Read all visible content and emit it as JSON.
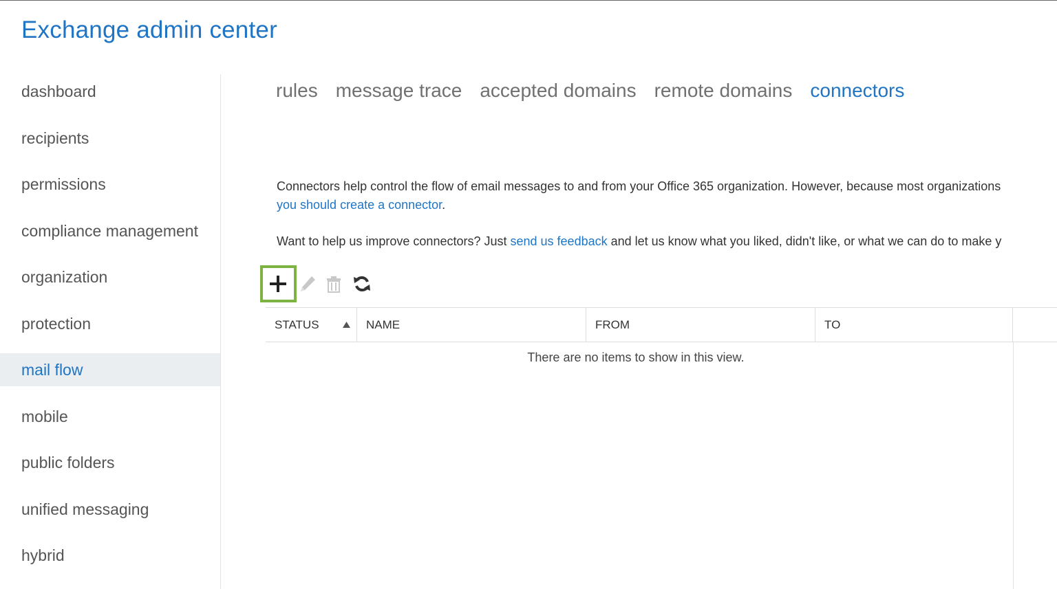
{
  "app": {
    "title": "Exchange admin center"
  },
  "sidebar": {
    "items": [
      {
        "label": "dashboard",
        "active": false
      },
      {
        "label": "recipients",
        "active": false
      },
      {
        "label": "permissions",
        "active": false
      },
      {
        "label": "compliance management",
        "active": false
      },
      {
        "label": "organization",
        "active": false
      },
      {
        "label": "protection",
        "active": false
      },
      {
        "label": "mail flow",
        "active": true
      },
      {
        "label": "mobile",
        "active": false
      },
      {
        "label": "public folders",
        "active": false
      },
      {
        "label": "unified messaging",
        "active": false
      },
      {
        "label": "hybrid",
        "active": false
      }
    ]
  },
  "tabs": [
    {
      "label": "rules",
      "active": false
    },
    {
      "label": "message trace",
      "active": false
    },
    {
      "label": "accepted domains",
      "active": false
    },
    {
      "label": "remote domains",
      "active": false
    },
    {
      "label": "connectors",
      "active": true
    }
  ],
  "description": {
    "line1": "Connectors help control the flow of email messages to and from your Office 365 organization. However, because most organizations",
    "line2_link": "you should create a connector",
    "line2_suffix": ".",
    "feedback_prefix": "Want to help us improve connectors? Just ",
    "feedback_link": "send us feedback",
    "feedback_suffix": " and let us know what you liked, didn't like, or what we can do to make y"
  },
  "toolbar": {
    "add_icon": "plus-icon",
    "edit_icon": "pencil-icon",
    "delete_icon": "trash-icon",
    "refresh_icon": "refresh-icon",
    "highlight_color": "#7cb342"
  },
  "table": {
    "columns": [
      "STATUS",
      "NAME",
      "FROM",
      "TO"
    ],
    "sort_column": "STATUS",
    "sort_direction": "ascending",
    "empty_message": "There are no items to show in this view."
  },
  "colors": {
    "accent": "#1f75c4",
    "active_nav_bg": "#eaeef0",
    "text": "#333333",
    "muted_text": "#707070"
  }
}
